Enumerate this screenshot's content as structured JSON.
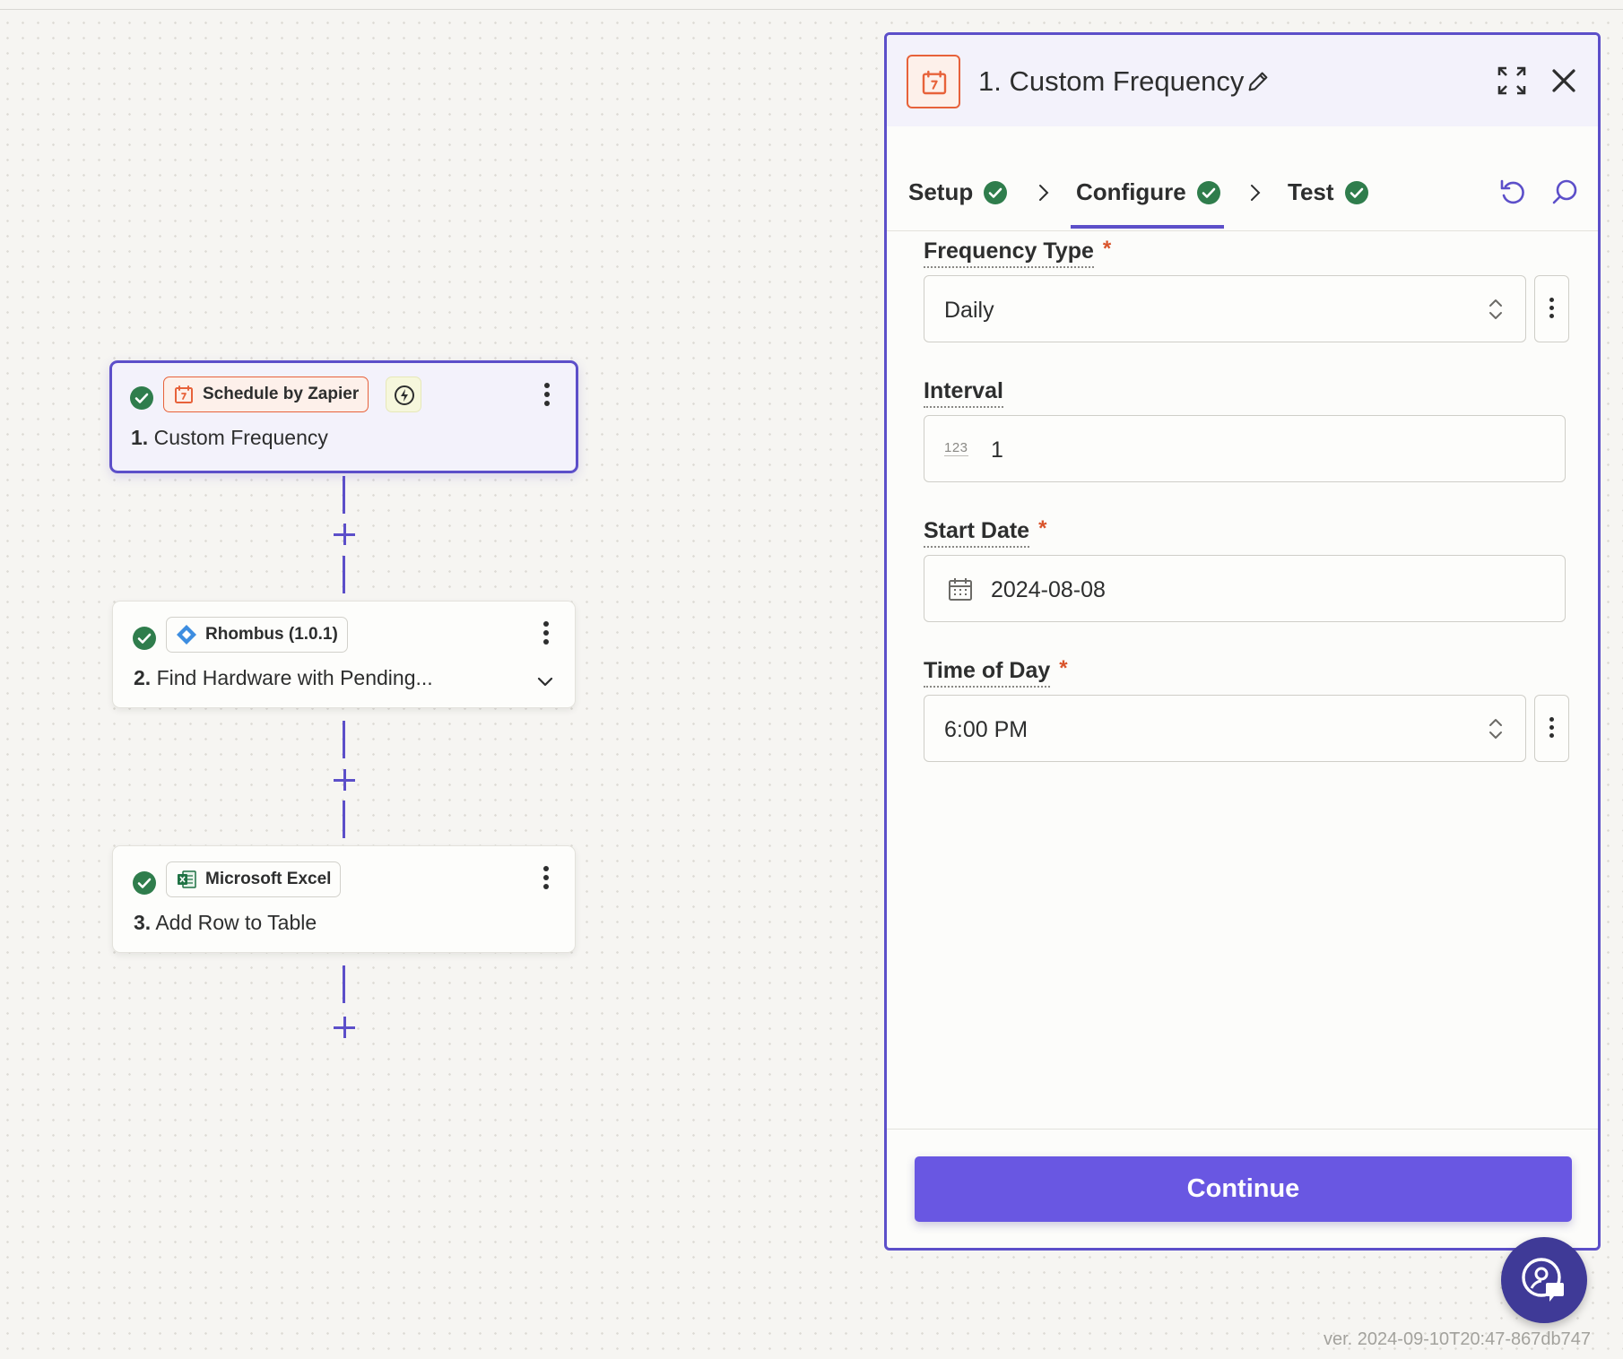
{
  "workflow": {
    "steps": [
      {
        "app_name": "Schedule by Zapier",
        "number": "1.",
        "title": "Custom Frequency",
        "app_icon": "calendar-icon",
        "selected": true
      },
      {
        "app_name": "Rhombus (1.0.1)",
        "number": "2.",
        "title": "Find Hardware with Pending...",
        "app_icon": "rhombus-icon",
        "selected": false
      },
      {
        "app_name": "Microsoft Excel",
        "number": "3.",
        "title": "Add Row to Table",
        "app_icon": "excel-icon",
        "selected": false
      }
    ]
  },
  "panel": {
    "title": "1. Custom Frequency",
    "tabs": [
      {
        "label": "Setup",
        "complete": true
      },
      {
        "label": "Configure",
        "complete": true,
        "active": true
      },
      {
        "label": "Test",
        "complete": true
      }
    ],
    "fields": {
      "frequency_type": {
        "label": "Frequency Type",
        "required": "*",
        "value": "Daily"
      },
      "interval": {
        "label": "Interval",
        "icon_text": "123",
        "value": "1"
      },
      "start_date": {
        "label": "Start Date",
        "required": "*",
        "value": "2024-08-08"
      },
      "time_of_day": {
        "label": "Time of Day",
        "required": "*",
        "value": "6:00 PM"
      }
    },
    "continue_label": "Continue"
  },
  "version": "ver. 2024-09-10T20:47-867db747",
  "colors": {
    "accent": "#5c4fc9",
    "button": "#6957e2",
    "success": "#2f7d4c",
    "schedule_orange": "#e7623a",
    "required": "#d9542b"
  }
}
